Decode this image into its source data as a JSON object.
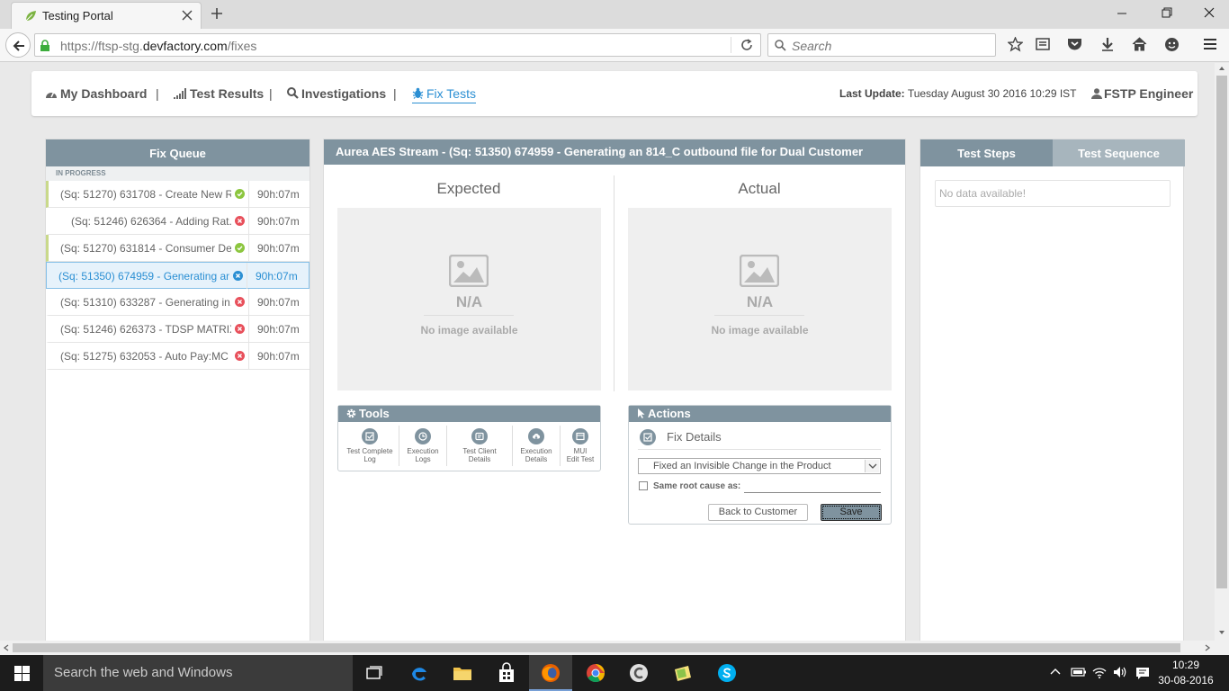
{
  "browser": {
    "tab_title": "Testing Portal",
    "url_prefix": "https://ftsp-stg.",
    "url_domain": "devfactory.com",
    "url_path": "/fixes",
    "search_placeholder": "Search"
  },
  "nav": {
    "dashboard": "My Dashboard",
    "test_results": "Test Results",
    "investigations": "Investigations",
    "fix_tests": "Fix Tests",
    "separator": "|",
    "last_update_label": "Last Update:",
    "last_update_value": "Tuesday August 30 2016 10:29 IST",
    "user": "FSTP Engineer"
  },
  "queue": {
    "title": "Fix Queue",
    "section": "IN PROGRESS",
    "rows": [
      {
        "text": "(Sq: 51270) 631708 - Create New R...",
        "status": "pass",
        "time": "90h:07m"
      },
      {
        "text": "(Sq: 51246) 626364 - Adding Rat...",
        "status": "fail",
        "time": "90h:07m"
      },
      {
        "text": "(Sq: 51270) 631814 - Consumer De...",
        "status": "pass",
        "time": "90h:07m"
      },
      {
        "text": "(Sq: 51350) 674959 - Generating an...",
        "status": "active",
        "time": "90h:07m"
      },
      {
        "text": "(Sq: 51310) 633287 - Generating in...",
        "status": "fail",
        "time": "90h:07m"
      },
      {
        "text": "(Sq: 51246) 626373 - TDSP MATRIX ...",
        "status": "fail",
        "time": "90h:07m"
      },
      {
        "text": "(Sq: 51275) 632053 - Auto Pay:MC (...",
        "status": "fail",
        "time": "90h:07m"
      }
    ]
  },
  "detail": {
    "title": "Aurea AES Stream - (Sq: 51350) 674959 - Generating an 814_C outbound file for Dual Customer",
    "expected": "Expected",
    "actual": "Actual",
    "na": "N/A",
    "no_image": "No image available"
  },
  "tools": {
    "title": "Tools",
    "items": [
      {
        "line1": "Test Complete",
        "line2": "Log"
      },
      {
        "line1": "Execution",
        "line2": "Logs"
      },
      {
        "line1": "Test Client",
        "line2": "Details"
      },
      {
        "line1": "Execution",
        "line2": "Details"
      },
      {
        "line1": "MUI",
        "line2": "Edit Test"
      }
    ]
  },
  "actions": {
    "title": "Actions",
    "fix_details": "Fix Details",
    "selected_option": "Fixed an Invisible Change in the Product",
    "same_root_label": "Same root cause as:",
    "back_button": "Back to Customer",
    "save_button": "Save"
  },
  "steps": {
    "tab_steps": "Test Steps",
    "tab_sequence": "Test Sequence",
    "no_data": "No data available!"
  },
  "taskbar": {
    "search_placeholder": "Search the web and Windows",
    "time": "10:29",
    "date": "30-08-2016"
  },
  "colors": {
    "panel_header": "#7f939f",
    "accent": "#2b8fd3",
    "pass": "#8cc63f",
    "fail": "#e8505b"
  }
}
